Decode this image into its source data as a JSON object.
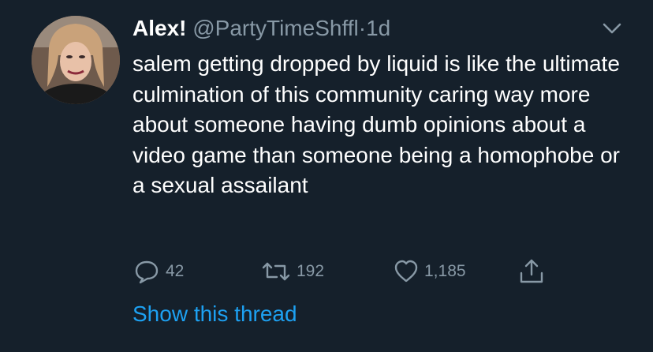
{
  "tweet": {
    "author_name": "Alex!",
    "handle": "@PartyTimeShffl",
    "separator": "·",
    "time": "1d",
    "text": "salem getting dropped by liquid is like the ultimate culmination of this community caring way more about someone having dumb opinions about a video game than someone being a homophobe or a sexual assailant",
    "show_thread_label": "Show this thread"
  },
  "actions": {
    "replies": "42",
    "retweets": "192",
    "likes": "1,185"
  },
  "icons": {
    "reply": "reply-icon",
    "retweet": "retweet-icon",
    "like": "heart-icon",
    "share": "share-icon",
    "menu": "chevron-down-icon"
  },
  "colors": {
    "background": "#15202b",
    "primary_text": "#ffffff",
    "secondary_text": "#8899a6",
    "link": "#1da1f2"
  }
}
